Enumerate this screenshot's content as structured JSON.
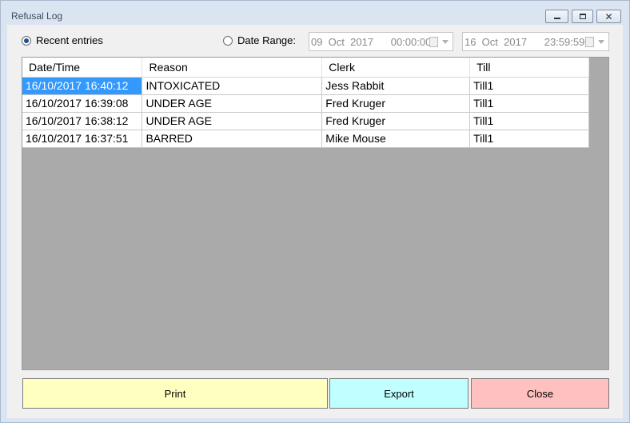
{
  "window": {
    "title": "Refusal Log"
  },
  "filters": {
    "recent_label": "Recent entries",
    "range_label": "Date Range:",
    "from": "09  Oct  2017      00:00:00",
    "to": "16  Oct  2017      23:59:59"
  },
  "table": {
    "columns": [
      "Date/Time",
      "Reason",
      "Clerk",
      "Till"
    ],
    "rows": [
      [
        "16/10/2017 16:40:12",
        "INTOXICATED",
        "Jess Rabbit",
        "Till1"
      ],
      [
        "16/10/2017 16:39:08",
        "UNDER AGE",
        "Fred Kruger",
        "Till1"
      ],
      [
        "16/10/2017 16:38:12",
        "UNDER AGE",
        "Fred Kruger",
        "Till1"
      ],
      [
        "16/10/2017 16:37:51",
        "BARRED",
        "Mike Mouse",
        "Till1"
      ]
    ]
  },
  "buttons": {
    "print": "Print",
    "export": "Export",
    "close": "Close"
  },
  "colors": {
    "print": "#ffffc0",
    "export": "#c0ffff",
    "close": "#ffc0c0",
    "selection": "#3399ff"
  }
}
